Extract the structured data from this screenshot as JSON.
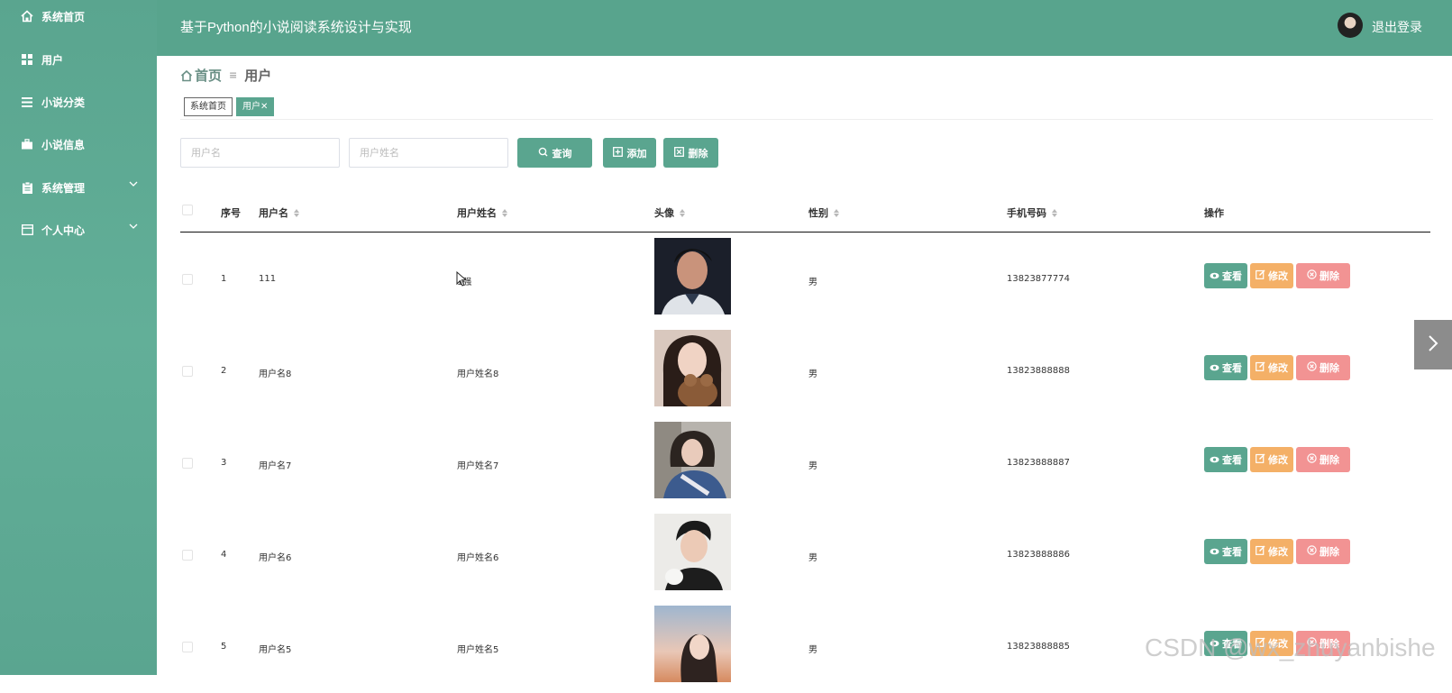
{
  "sidebar": {
    "items": [
      {
        "label": "系统首页",
        "icon": "home-icon",
        "has_arrow": false
      },
      {
        "label": "用户",
        "icon": "grid-icon",
        "has_arrow": false
      },
      {
        "label": "小说分类",
        "icon": "list-icon",
        "has_arrow": false
      },
      {
        "label": "小说信息",
        "icon": "briefcase-icon",
        "has_arrow": false
      },
      {
        "label": "系统管理",
        "icon": "clipboard-icon",
        "has_arrow": true
      },
      {
        "label": "个人中心",
        "icon": "id-card-icon",
        "has_arrow": true
      }
    ]
  },
  "header": {
    "title": "基于Python的小说阅读系统设计与实现",
    "logout": "退出登录"
  },
  "breadcrumb": {
    "home": "首页",
    "current": "用户"
  },
  "tags": [
    {
      "label": "系统首页",
      "active": false
    },
    {
      "label": "用户",
      "close": "✕",
      "active": true
    }
  ],
  "search": {
    "username_placeholder": "用户名",
    "name_placeholder": "用户姓名",
    "query_label": "查询",
    "add_label": "添加",
    "delete_label": "删除"
  },
  "table": {
    "columns": [
      "序号",
      "用户名",
      "用户姓名",
      "头像",
      "性别",
      "手机号码",
      "操作"
    ],
    "rows": [
      {
        "index": "1",
        "username": "111",
        "name": "1强",
        "gender": "男",
        "phone": "13823877774"
      },
      {
        "index": "2",
        "username": "用户名8",
        "name": "用户姓名8",
        "gender": "男",
        "phone": "13823888888"
      },
      {
        "index": "3",
        "username": "用户名7",
        "name": "用户姓名7",
        "gender": "男",
        "phone": "13823888887"
      },
      {
        "index": "4",
        "username": "用户名6",
        "name": "用户姓名6",
        "gender": "男",
        "phone": "13823888886"
      },
      {
        "index": "5",
        "username": "用户名5",
        "name": "用户姓名5",
        "gender": "男",
        "phone": "13823888885"
      }
    ],
    "actions": {
      "view": "查看",
      "edit": "修改",
      "delete": "删除"
    }
  },
  "watermark": "CSDN @wx_zhuyanbishe",
  "colors": {
    "primary": "#5aa58f",
    "edit": "#f4b067",
    "delete": "#f29393"
  }
}
